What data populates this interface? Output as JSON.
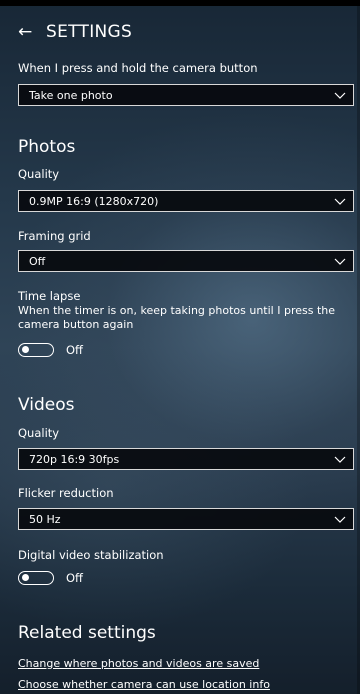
{
  "header": {
    "back_icon": "back-arrow-icon",
    "title": "SETTINGS"
  },
  "camera_button": {
    "label": "When I press and hold the camera button",
    "value": "Take one photo"
  },
  "photos": {
    "title": "Photos",
    "quality_label": "Quality",
    "quality_value": "0.9MP 16:9 (1280x720)",
    "framing_label": "Framing grid",
    "framing_value": "Off",
    "timelapse_label": "Time lapse",
    "timelapse_desc": "When the timer is on, keep taking photos until I press the camera button again",
    "timelapse_state": "Off"
  },
  "videos": {
    "title": "Videos",
    "quality_label": "Quality",
    "quality_value": "720p 16:9 30fps",
    "flicker_label": "Flicker reduction",
    "flicker_value": "50 Hz",
    "stabilization_label": "Digital video stabilization",
    "stabilization_state": "Off"
  },
  "related": {
    "title": "Related settings",
    "links": [
      "Change where photos and videos are saved",
      "Choose whether camera can use location info"
    ]
  },
  "colors": {
    "background_top": "#182736",
    "background_mid": "#2f4457",
    "dropdown_bg": "#080a0e",
    "border": "#d8d8d8"
  },
  "icons": {
    "dropdown": "chevron-down-icon",
    "toggle": "toggle-switch-icon"
  }
}
